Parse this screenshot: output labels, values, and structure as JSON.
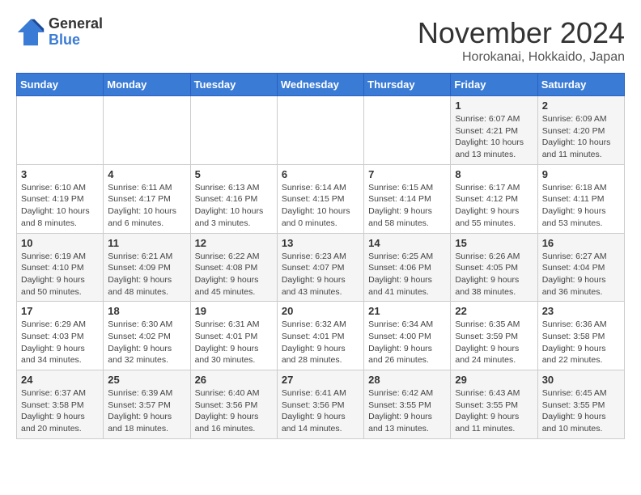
{
  "logo": {
    "general": "General",
    "blue": "Blue"
  },
  "title": "November 2024",
  "subtitle": "Horokanai, Hokkaido, Japan",
  "headers": [
    "Sunday",
    "Monday",
    "Tuesday",
    "Wednesday",
    "Thursday",
    "Friday",
    "Saturday"
  ],
  "weeks": [
    [
      {
        "day": "",
        "info": ""
      },
      {
        "day": "",
        "info": ""
      },
      {
        "day": "",
        "info": ""
      },
      {
        "day": "",
        "info": ""
      },
      {
        "day": "",
        "info": ""
      },
      {
        "day": "1",
        "info": "Sunrise: 6:07 AM\nSunset: 4:21 PM\nDaylight: 10 hours and 13 minutes."
      },
      {
        "day": "2",
        "info": "Sunrise: 6:09 AM\nSunset: 4:20 PM\nDaylight: 10 hours and 11 minutes."
      }
    ],
    [
      {
        "day": "3",
        "info": "Sunrise: 6:10 AM\nSunset: 4:19 PM\nDaylight: 10 hours and 8 minutes."
      },
      {
        "day": "4",
        "info": "Sunrise: 6:11 AM\nSunset: 4:17 PM\nDaylight: 10 hours and 6 minutes."
      },
      {
        "day": "5",
        "info": "Sunrise: 6:13 AM\nSunset: 4:16 PM\nDaylight: 10 hours and 3 minutes."
      },
      {
        "day": "6",
        "info": "Sunrise: 6:14 AM\nSunset: 4:15 PM\nDaylight: 10 hours and 0 minutes."
      },
      {
        "day": "7",
        "info": "Sunrise: 6:15 AM\nSunset: 4:14 PM\nDaylight: 9 hours and 58 minutes."
      },
      {
        "day": "8",
        "info": "Sunrise: 6:17 AM\nSunset: 4:12 PM\nDaylight: 9 hours and 55 minutes."
      },
      {
        "day": "9",
        "info": "Sunrise: 6:18 AM\nSunset: 4:11 PM\nDaylight: 9 hours and 53 minutes."
      }
    ],
    [
      {
        "day": "10",
        "info": "Sunrise: 6:19 AM\nSunset: 4:10 PM\nDaylight: 9 hours and 50 minutes."
      },
      {
        "day": "11",
        "info": "Sunrise: 6:21 AM\nSunset: 4:09 PM\nDaylight: 9 hours and 48 minutes."
      },
      {
        "day": "12",
        "info": "Sunrise: 6:22 AM\nSunset: 4:08 PM\nDaylight: 9 hours and 45 minutes."
      },
      {
        "day": "13",
        "info": "Sunrise: 6:23 AM\nSunset: 4:07 PM\nDaylight: 9 hours and 43 minutes."
      },
      {
        "day": "14",
        "info": "Sunrise: 6:25 AM\nSunset: 4:06 PM\nDaylight: 9 hours and 41 minutes."
      },
      {
        "day": "15",
        "info": "Sunrise: 6:26 AM\nSunset: 4:05 PM\nDaylight: 9 hours and 38 minutes."
      },
      {
        "day": "16",
        "info": "Sunrise: 6:27 AM\nSunset: 4:04 PM\nDaylight: 9 hours and 36 minutes."
      }
    ],
    [
      {
        "day": "17",
        "info": "Sunrise: 6:29 AM\nSunset: 4:03 PM\nDaylight: 9 hours and 34 minutes."
      },
      {
        "day": "18",
        "info": "Sunrise: 6:30 AM\nSunset: 4:02 PM\nDaylight: 9 hours and 32 minutes."
      },
      {
        "day": "19",
        "info": "Sunrise: 6:31 AM\nSunset: 4:01 PM\nDaylight: 9 hours and 30 minutes."
      },
      {
        "day": "20",
        "info": "Sunrise: 6:32 AM\nSunset: 4:01 PM\nDaylight: 9 hours and 28 minutes."
      },
      {
        "day": "21",
        "info": "Sunrise: 6:34 AM\nSunset: 4:00 PM\nDaylight: 9 hours and 26 minutes."
      },
      {
        "day": "22",
        "info": "Sunrise: 6:35 AM\nSunset: 3:59 PM\nDaylight: 9 hours and 24 minutes."
      },
      {
        "day": "23",
        "info": "Sunrise: 6:36 AM\nSunset: 3:58 PM\nDaylight: 9 hours and 22 minutes."
      }
    ],
    [
      {
        "day": "24",
        "info": "Sunrise: 6:37 AM\nSunset: 3:58 PM\nDaylight: 9 hours and 20 minutes."
      },
      {
        "day": "25",
        "info": "Sunrise: 6:39 AM\nSunset: 3:57 PM\nDaylight: 9 hours and 18 minutes."
      },
      {
        "day": "26",
        "info": "Sunrise: 6:40 AM\nSunset: 3:56 PM\nDaylight: 9 hours and 16 minutes."
      },
      {
        "day": "27",
        "info": "Sunrise: 6:41 AM\nSunset: 3:56 PM\nDaylight: 9 hours and 14 minutes."
      },
      {
        "day": "28",
        "info": "Sunrise: 6:42 AM\nSunset: 3:55 PM\nDaylight: 9 hours and 13 minutes."
      },
      {
        "day": "29",
        "info": "Sunrise: 6:43 AM\nSunset: 3:55 PM\nDaylight: 9 hours and 11 minutes."
      },
      {
        "day": "30",
        "info": "Sunrise: 6:45 AM\nSunset: 3:55 PM\nDaylight: 9 hours and 10 minutes."
      }
    ]
  ]
}
